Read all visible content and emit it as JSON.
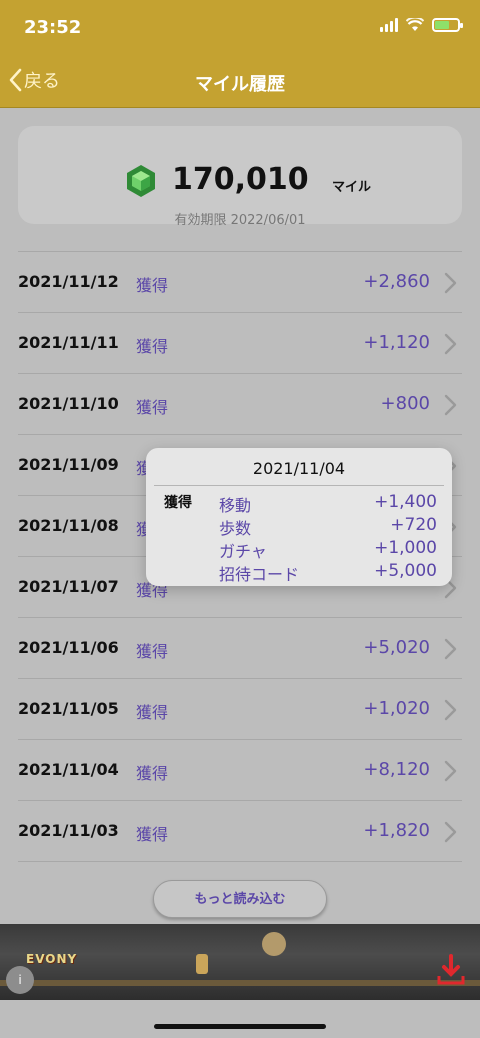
{
  "status_bar": {
    "time": "23:52"
  },
  "nav": {
    "back_label": "戻る",
    "title": "マイル履歴"
  },
  "summary": {
    "miles": "170,010",
    "unit": "マイル",
    "expiry": "有効期限 2022/06/01"
  },
  "history": [
    {
      "date": "2021/11/12",
      "type": "獲得",
      "amount": "+2,860"
    },
    {
      "date": "2021/11/11",
      "type": "獲得",
      "amount": "+1,120"
    },
    {
      "date": "2021/11/10",
      "type": "獲得",
      "amount": "+800"
    },
    {
      "date": "2021/11/09",
      "type": "獲得",
      "amount": ""
    },
    {
      "date": "2021/11/08",
      "type": "獲得",
      "amount": ""
    },
    {
      "date": "2021/11/07",
      "type": "獲得",
      "amount": ""
    },
    {
      "date": "2021/11/06",
      "type": "獲得",
      "amount": "+5,020"
    },
    {
      "date": "2021/11/05",
      "type": "獲得",
      "amount": "+1,020"
    },
    {
      "date": "2021/11/04",
      "type": "獲得",
      "amount": "+8,120"
    },
    {
      "date": "2021/11/03",
      "type": "獲得",
      "amount": "+1,820"
    }
  ],
  "load_more_label": "もっと読み込む",
  "popup": {
    "date": "2021/11/04",
    "type": "獲得",
    "items": [
      {
        "label": "移動",
        "amount": "+1,400"
      },
      {
        "label": "歩数",
        "amount": "+720"
      },
      {
        "label": "ガチャ",
        "amount": "+1,000"
      },
      {
        "label": "招待コード",
        "amount": "+5,000"
      }
    ]
  },
  "ad": {
    "logo": "EVONY"
  },
  "colors": {
    "header": "#c4a231",
    "accent": "#5b47a8",
    "background": "#bdbdbd"
  }
}
